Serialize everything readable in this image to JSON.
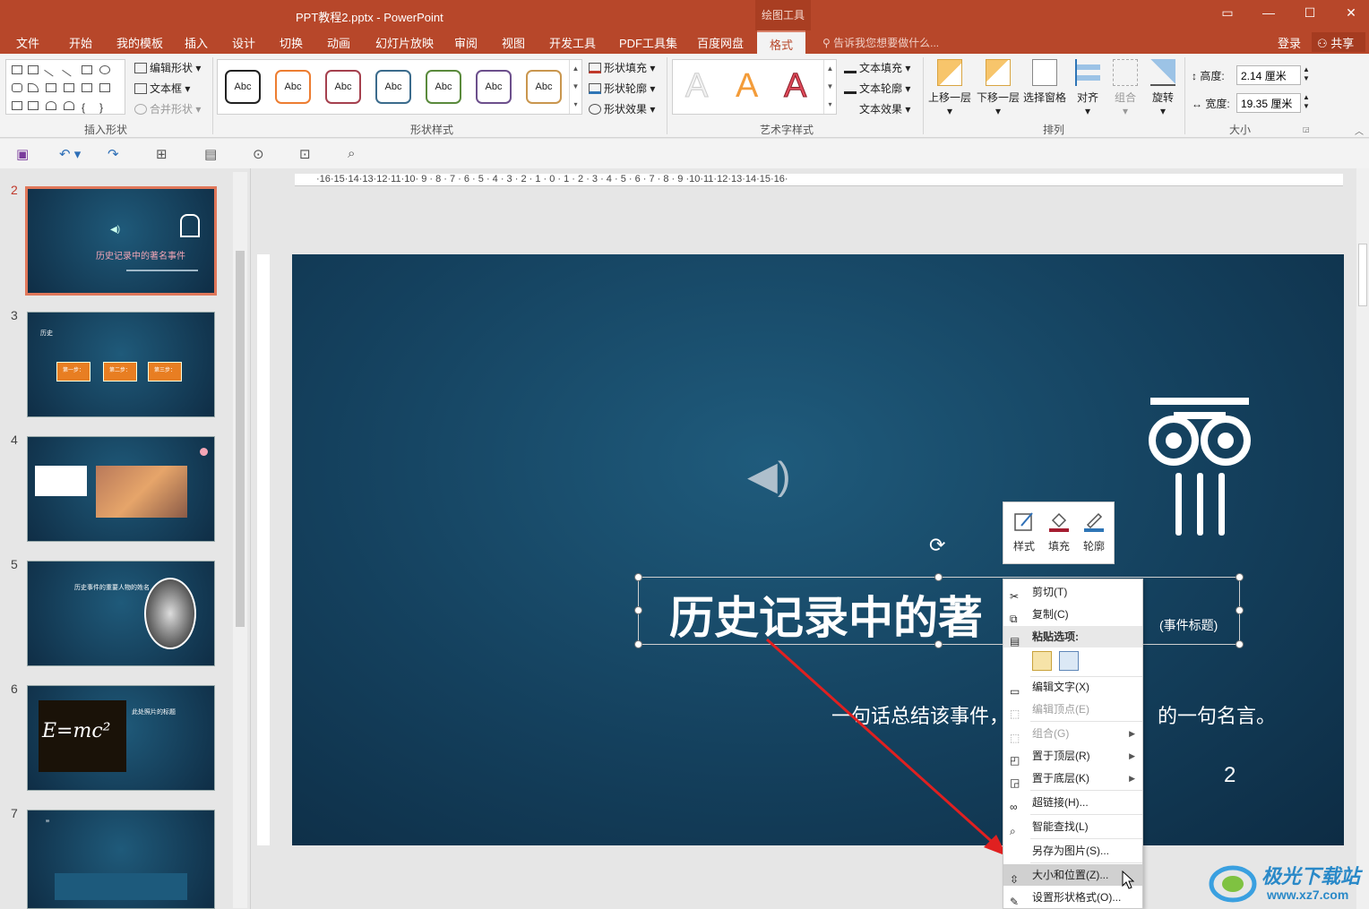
{
  "window": {
    "title": "PPT教程2.pptx - PowerPoint",
    "contextual_tab_group": "绘图工具",
    "controls": [
      "▭",
      "—",
      "☐",
      "✕"
    ]
  },
  "tabs": [
    "文件",
    "开始",
    "我的模板",
    "插入",
    "设计",
    "切换",
    "动画",
    "幻灯片放映",
    "审阅",
    "视图",
    "开发工具",
    "PDF工具集",
    "百度网盘",
    "格式"
  ],
  "active_tab": "格式",
  "tell_me": "告诉我您想要做什么...",
  "login": "登录",
  "share": "共享",
  "ribbon": {
    "insert_shapes": {
      "label": "插入形状",
      "edit_shape": "编辑形状",
      "text_box": "文本框",
      "merge_shapes": "合并形状"
    },
    "shape_styles": {
      "label": "形状样式",
      "preset": "Abc",
      "preset_colors": [
        "#222222",
        "#ed7d31",
        "#a5404e",
        "#3b6b8c",
        "#5a8a3c",
        "#6c4f8c",
        "#c9964e"
      ],
      "fill": "形状填充",
      "outline": "形状轮廓",
      "effects": "形状效果"
    },
    "wordart_styles": {
      "label": "艺术字样式",
      "glyph": "A",
      "text_fill": "文本填充",
      "text_outline": "文本轮廓",
      "text_effects": "文本效果"
    },
    "arrange": {
      "label": "排列",
      "bring_forward": "上移一层",
      "send_backward": "下移一层",
      "selection_pane": "选择窗格",
      "align": "对齐",
      "group": "组合",
      "rotate": "旋转"
    },
    "size": {
      "label": "大小",
      "height_label": "高度:",
      "height_value": "2.14 厘米",
      "width_label": "宽度:",
      "width_value": "19.35 厘米"
    }
  },
  "thumbnails": [
    {
      "number": "2",
      "title": "历史记录中的著名事件",
      "selected": true
    },
    {
      "number": "3",
      "title": "历史",
      "steps": [
        "第一步：",
        "第二步：",
        "第三步："
      ]
    },
    {
      "number": "4"
    },
    {
      "number": "5",
      "title": "历史事件的重要人物的姓名"
    },
    {
      "number": "6",
      "title": "此处照片的标题",
      "formula": "E=mc²"
    },
    {
      "number": "7",
      "quote_mark": "”"
    }
  ],
  "slide": {
    "title": "历史记录中的著名事件",
    "title_visible": "历史记录中的著",
    "title_tag": "(事件标题)",
    "subtitle_left": "一句话总结该事件，",
    "subtitle_right": "的一句名言。",
    "page_number": "2"
  },
  "mini_toolbar": [
    "样式",
    "填充",
    "轮廓"
  ],
  "context_menu": [
    {
      "label": "剪切(T)",
      "icon": "scissors-icon"
    },
    {
      "label": "复制(C)",
      "icon": "copy-icon"
    },
    {
      "label": "粘贴选项:",
      "icon": "paste-icon",
      "header": true
    },
    {
      "label": "编辑文字(X)",
      "icon": "edit-text-icon"
    },
    {
      "label": "编辑顶点(E)",
      "icon": "edit-points-icon",
      "disabled": true
    },
    {
      "label": "组合(G)",
      "icon": "group-icon",
      "disabled": true,
      "submenu": true
    },
    {
      "label": "置于顶层(R)",
      "icon": "bring-front-icon",
      "submenu": true
    },
    {
      "label": "置于底层(K)",
      "icon": "send-back-icon",
      "submenu": true
    },
    {
      "label": "超链接(H)...",
      "icon": "link-icon"
    },
    {
      "label": "智能查找(L)",
      "icon": "search-icon"
    },
    {
      "label": "另存为图片(S)...",
      "icon": ""
    },
    {
      "label": "大小和位置(Z)...",
      "icon": "size-position-icon",
      "highlighted": true
    },
    {
      "label": "设置形状格式(O)...",
      "icon": "format-shape-icon"
    }
  ],
  "watermark": {
    "text": "极光下载站",
    "url": "www.xz7.com"
  },
  "colors": {
    "accent": "#b7472a",
    "slide_bg": "#14405d",
    "arrow": "#e02020"
  }
}
